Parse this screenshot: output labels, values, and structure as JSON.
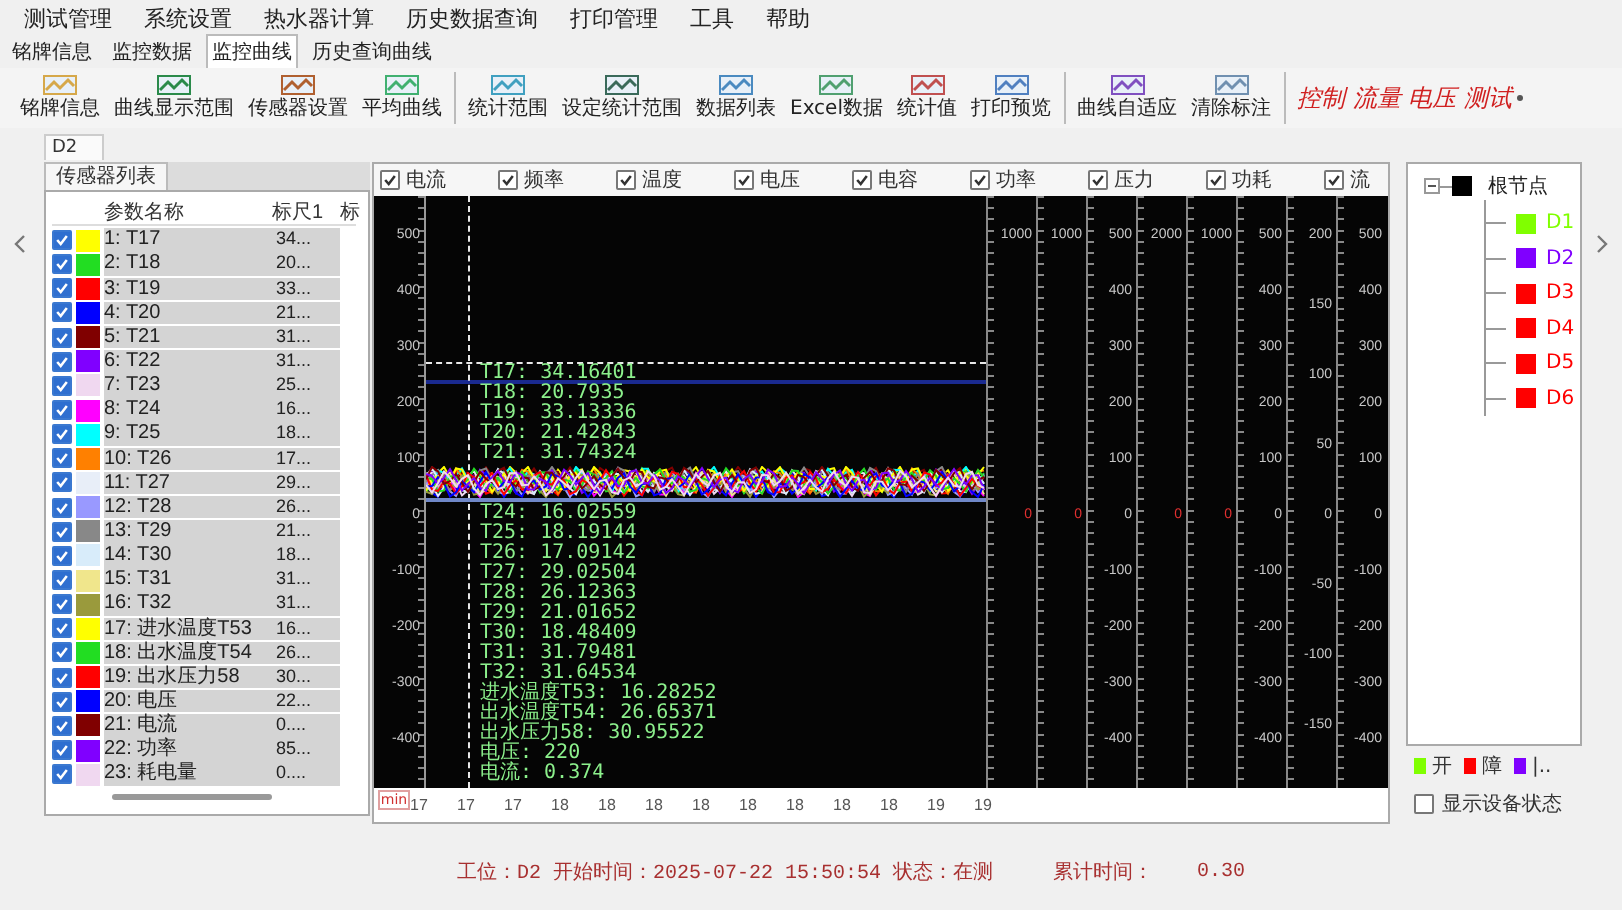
{
  "menu": [
    "测试管理",
    "系统设置",
    "热水器计算",
    "历史数据查询",
    "打印管理",
    "工具",
    "帮助"
  ],
  "view_tabs": [
    {
      "label": "铭牌信息",
      "selected": false
    },
    {
      "label": "监控数据",
      "selected": false
    },
    {
      "label": "监控曲线",
      "selected": true
    },
    {
      "label": "历史查询曲线",
      "selected": false
    }
  ],
  "toolbar_groups": [
    {
      "buttons": [
        "铭牌信息",
        "曲线显示范围",
        "传感器设置",
        "平均曲线"
      ]
    },
    {
      "buttons": [
        "统计范围",
        "设定统计范围",
        "数据列表",
        "Excel数据",
        "统计值",
        "打印预览"
      ]
    },
    {
      "buttons": [
        "曲线自适应",
        "清除标注"
      ]
    }
  ],
  "mode_selector": {
    "value": "控制 流量 电压 测试"
  },
  "document_tab": {
    "label": "D2"
  },
  "sensors": {
    "tab": "传感器列表",
    "columns": [
      "参数名称",
      "标尺1",
      "标"
    ],
    "rows": [
      {
        "name": "1: T17",
        "scale": "34...",
        "checked": true,
        "color": "#ffff00"
      },
      {
        "name": "2: T18",
        "scale": "20...",
        "checked": true,
        "color": "#22dd22"
      },
      {
        "name": "3: T19",
        "scale": "33...",
        "checked": true,
        "color": "#ff0000"
      },
      {
        "name": "4: T20",
        "scale": "21...",
        "checked": true,
        "color": "#0000ff"
      },
      {
        "name": "5: T21",
        "scale": "31...",
        "checked": true,
        "color": "#800000"
      },
      {
        "name": "6: T22",
        "scale": "31...",
        "checked": true,
        "color": "#8000ff"
      },
      {
        "name": "7: T23",
        "scale": "25...",
        "checked": true,
        "color": "#f0d8f0"
      },
      {
        "name": "8: T24",
        "scale": "16...",
        "checked": true,
        "color": "#ff00ff"
      },
      {
        "name": "9: T25",
        "scale": "18...",
        "checked": true,
        "color": "#00ffff"
      },
      {
        "name": "10: T26",
        "scale": "17...",
        "checked": true,
        "color": "#ff8000"
      },
      {
        "name": "11: T27",
        "scale": "29...",
        "checked": true,
        "color": "#e8eef8"
      },
      {
        "name": "12: T28",
        "scale": "26...",
        "checked": true,
        "color": "#9999ff"
      },
      {
        "name": "13: T29",
        "scale": "21...",
        "checked": true,
        "color": "#888888"
      },
      {
        "name": "14: T30",
        "scale": "18...",
        "checked": true,
        "color": "#d8ecfa"
      },
      {
        "name": "15: T31",
        "scale": "31...",
        "checked": true,
        "color": "#f0e68c"
      },
      {
        "name": "16: T32",
        "scale": "31...",
        "checked": true,
        "color": "#9a9a3c"
      },
      {
        "name": "17: 进水温度T53",
        "scale": "16...",
        "checked": true,
        "color": "#ffff00"
      },
      {
        "name": "18: 出水温度T54",
        "scale": "26...",
        "checked": true,
        "color": "#22dd22"
      },
      {
        "name": "19: 出水压力58",
        "scale": "30...",
        "checked": true,
        "color": "#ff0000"
      },
      {
        "name": "20: 电压",
        "scale": "22...",
        "checked": true,
        "color": "#0000ff"
      },
      {
        "name": "21: 电流",
        "scale": "0....",
        "checked": true,
        "color": "#800000"
      },
      {
        "name": "22: 功率",
        "scale": "85...",
        "checked": true,
        "color": "#8000ff"
      },
      {
        "name": "23: 耗电量",
        "scale": "0....",
        "checked": true,
        "color": "#f0d8f0"
      }
    ]
  },
  "chart": {
    "legend": [
      {
        "label": "电流",
        "checked": true
      },
      {
        "label": "频率",
        "checked": true
      },
      {
        "label": "温度",
        "checked": true
      },
      {
        "label": "电压",
        "checked": true
      },
      {
        "label": "电容",
        "checked": true
      },
      {
        "label": "功率",
        "checked": true
      },
      {
        "label": "压力",
        "checked": true
      },
      {
        "label": "功耗",
        "checked": true
      },
      {
        "label": "流",
        "checked": true
      }
    ],
    "y_labels": [
      "500",
      "400",
      "300",
      "200",
      "100",
      "0",
      "-100",
      "-200",
      "-300",
      "-400"
    ],
    "x_unit": "min",
    "x_labels": [
      "17",
      "17",
      "17",
      "18",
      "18",
      "18",
      "18",
      "18",
      "18",
      "18",
      "18",
      "19",
      "19"
    ],
    "readout": [
      [
        "T17: 34.16401",
        "T18: 20.7935",
        "T19: 33.13336",
        "T20: 21.42843",
        "T21: 31.74324"
      ],
      [
        "T24: 16.02559",
        "T25: 18.19144",
        "T26: 17.09142",
        "T27: 29.02504",
        "T28: 26.12363",
        "T29: 21.01652",
        "T30: 18.48409",
        "T31: 31.79481",
        "T32: 31.64534",
        "进水温度T53: 16.28252",
        "出水温度T54: 26.65371",
        "出水压力58: 30.95522",
        "电压: 220",
        "电流: 0.374"
      ]
    ],
    "axes": [
      {
        "kind": "top",
        "label": "1000",
        "zero": "0"
      },
      {
        "kind": "top",
        "label": "1000",
        "zero": "0"
      },
      {
        "kind": "full",
        "labels": [
          "500",
          "400",
          "300",
          "200",
          "100",
          "0",
          "-100",
          "-200",
          "-300",
          "-400"
        ]
      },
      {
        "kind": "top",
        "label": "2000",
        "zero": "0"
      },
      {
        "kind": "top",
        "label": "1000",
        "zero": "0"
      },
      {
        "kind": "full",
        "labels": [
          "500",
          "400",
          "300",
          "200",
          "100",
          "0",
          "-100",
          "-200",
          "-300",
          "-400"
        ]
      },
      {
        "kind": "full",
        "labels": [
          "200",
          "150",
          "100",
          "50",
          "0",
          "-50",
          "-100",
          "-150"
        ]
      },
      {
        "kind": "full",
        "labels": [
          "500",
          "400",
          "300",
          "200",
          "100",
          "0",
          "-100",
          "-200",
          "-300",
          "-400"
        ]
      }
    ]
  },
  "device_tree": {
    "root": {
      "label": "根节点",
      "expanded": true,
      "color": "#000000",
      "children": [
        {
          "label": "D1",
          "color": "#80ff00"
        },
        {
          "label": "D2",
          "color": "#8000ff"
        },
        {
          "label": "D3",
          "color": "#ff0000"
        },
        {
          "label": "D4",
          "color": "#ff0000"
        },
        {
          "label": "D5",
          "color": "#ff0000"
        },
        {
          "label": "D6",
          "color": "#ff0000"
        }
      ]
    }
  },
  "status_legend": [
    {
      "label": "开",
      "color": "#80ff00"
    },
    {
      "label": "障",
      "color": "#ff0000"
    },
    {
      "label": "|..",
      "color": "#8000ff"
    }
  ],
  "show_device_status": {
    "label": "显示设备状态",
    "checked": false
  },
  "status_bar": {
    "info": "工位：D2 开始时间：2025-07-22 15:50:54 状态：在测",
    "elapsed_label": "累计时间：",
    "elapsed_value": "0.30"
  }
}
